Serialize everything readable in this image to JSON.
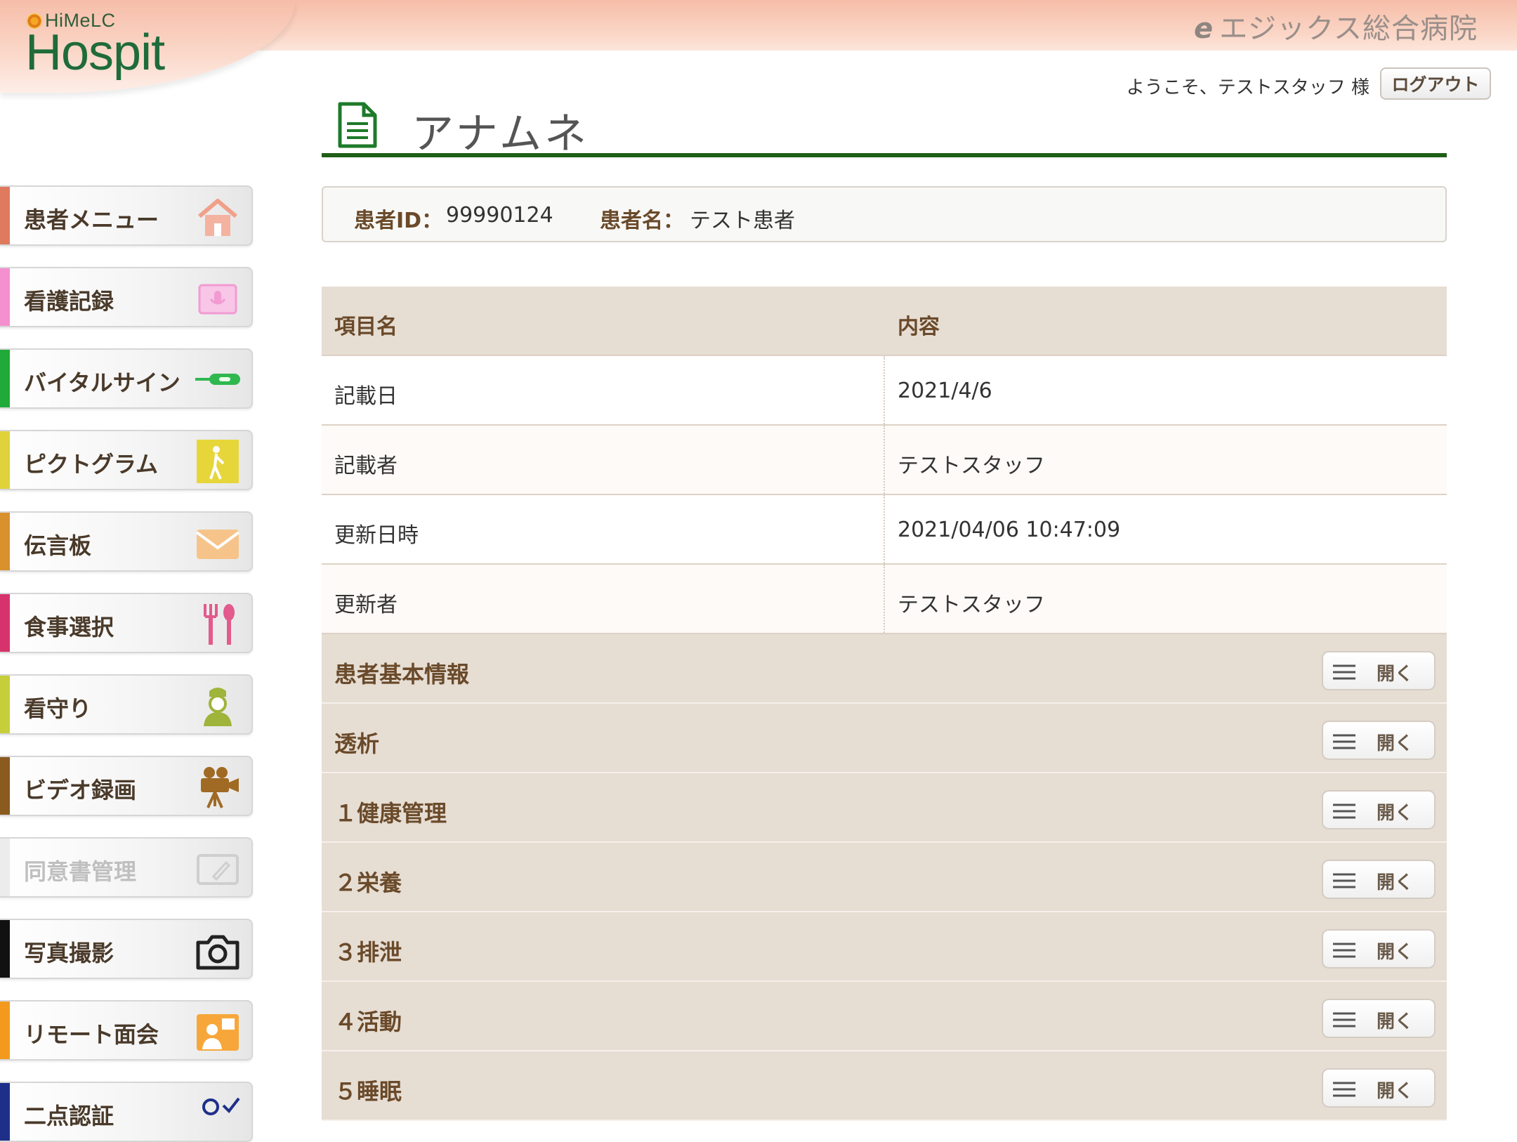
{
  "brand": {
    "small": "HiMeLC",
    "big": "Hospit",
    "hospital": "エジックス総合病院",
    "hospital_mark": "e"
  },
  "header": {
    "welcome": "ようこそ、テストスタッフ 様",
    "logout": "ログアウト"
  },
  "page": {
    "title": "アナムネ"
  },
  "sidebar": {
    "items": [
      {
        "label": "患者メニュー",
        "color": "#e07a5f",
        "icon": "home-icon"
      },
      {
        "label": "看護記録",
        "color": "#f48fd0",
        "icon": "microphone-screen-icon"
      },
      {
        "label": "バイタルサイン",
        "color": "#1faa3a",
        "icon": "thermometer-icon"
      },
      {
        "label": "ピクトグラム",
        "color": "#e0d23a",
        "icon": "pictogram-person-icon"
      },
      {
        "label": "伝言板",
        "color": "#d9912e",
        "icon": "envelope-icon"
      },
      {
        "label": "食事選択",
        "color": "#d6336c",
        "icon": "fork-spoon-icon"
      },
      {
        "label": "看守り",
        "color": "#c6cf3a",
        "icon": "nurse-icon"
      },
      {
        "label": "ビデオ録画",
        "color": "#8a5a1e",
        "icon": "video-camera-icon"
      },
      {
        "label": "同意書管理",
        "color": "#e6e6e6",
        "icon": "pen-document-icon",
        "disabled": true
      },
      {
        "label": "写真撮影",
        "color": "#111111",
        "icon": "camera-icon"
      },
      {
        "label": "リモート面会",
        "color": "#f39a1e",
        "icon": "video-call-icon"
      },
      {
        "label": "二点認証",
        "color": "#1e2f8a",
        "icon": "user-check-icon"
      }
    ]
  },
  "patient": {
    "id_label": "患者ID：",
    "id": "99990124",
    "name_label": "患者名：",
    "name": "テスト患者"
  },
  "table": {
    "headers": {
      "item": "項目名",
      "content": "内容"
    },
    "rows": [
      {
        "item": "記載日",
        "content": "2021/4/6"
      },
      {
        "item": "記載者",
        "content": "テストスタッフ"
      },
      {
        "item": "更新日時",
        "content": "2021/04/06 10:47:09"
      },
      {
        "item": "更新者",
        "content": "テストスタッフ"
      }
    ],
    "sections": [
      {
        "label": "患者基本情報",
        "button": "開く"
      },
      {
        "label": "透析",
        "button": "開く"
      },
      {
        "label": "１健康管理",
        "button": "開く"
      },
      {
        "label": "２栄養",
        "button": "開く"
      },
      {
        "label": "３排泄",
        "button": "開く"
      },
      {
        "label": "４活動",
        "button": "開く"
      },
      {
        "label": "５睡眠",
        "button": "開く"
      }
    ]
  }
}
